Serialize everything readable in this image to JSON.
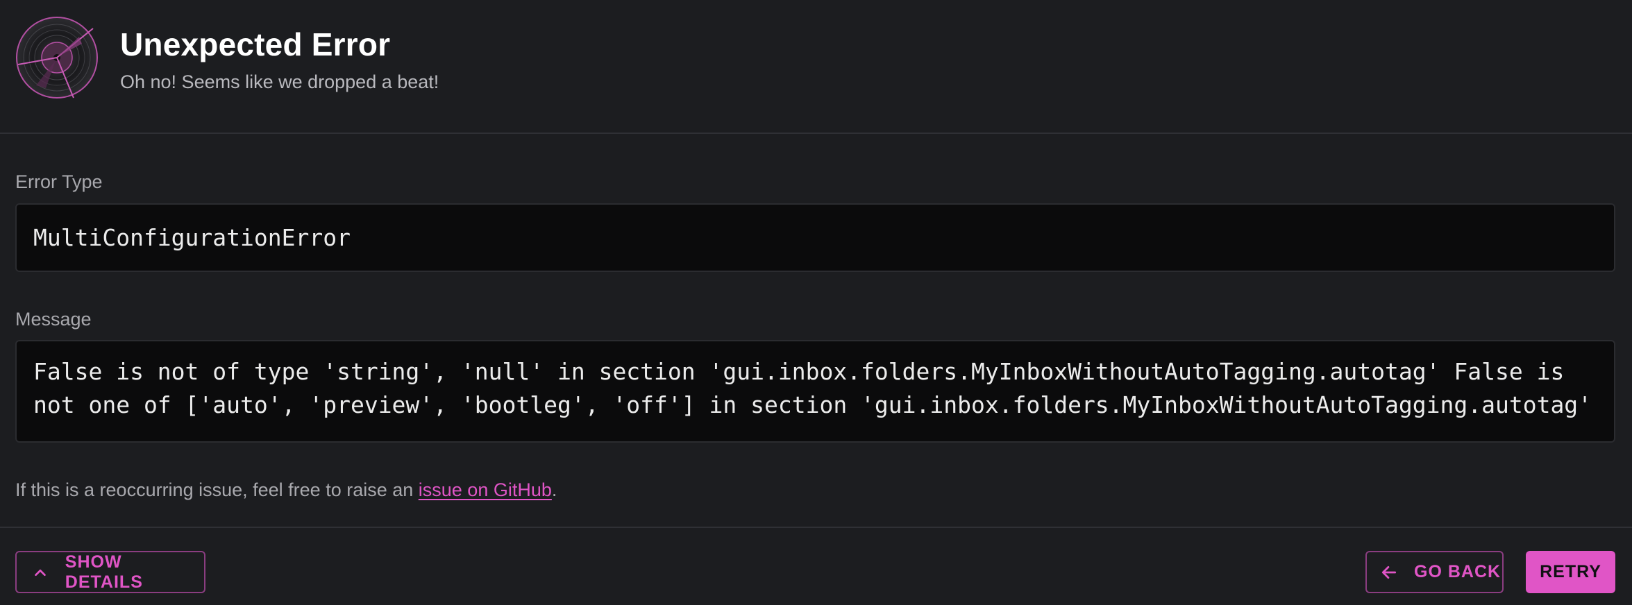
{
  "header": {
    "logo_icon": "broken-vinyl-record-icon",
    "title": "Unexpected Error",
    "subtitle": "Oh no! Seems like we dropped a beat!"
  },
  "error_type": {
    "label": "Error Type",
    "value": "MultiConfigurationError"
  },
  "message": {
    "label": "Message",
    "value": "False is not of type 'string', 'null' in section 'gui.inbox.folders.MyInboxWithoutAutoTagging.autotag' False is not one of ['auto', 'preview', 'bootleg', 'off'] in section 'gui.inbox.folders.MyInboxWithoutAutoTagging.autotag'"
  },
  "note": {
    "prefix": "If this is a reoccurring issue, feel free to raise an ",
    "link_text": "issue on GitHub",
    "suffix": "."
  },
  "footer": {
    "show_details_label": "SHOW DETAILS",
    "show_details_icon": "chevron-up-icon",
    "go_back_label": "GO BACK",
    "go_back_icon": "arrow-left-icon",
    "retry_label": "RETRY"
  },
  "colors": {
    "background": "#1c1d20",
    "accent": "#e055c6",
    "code_background": "#0b0b0c"
  }
}
